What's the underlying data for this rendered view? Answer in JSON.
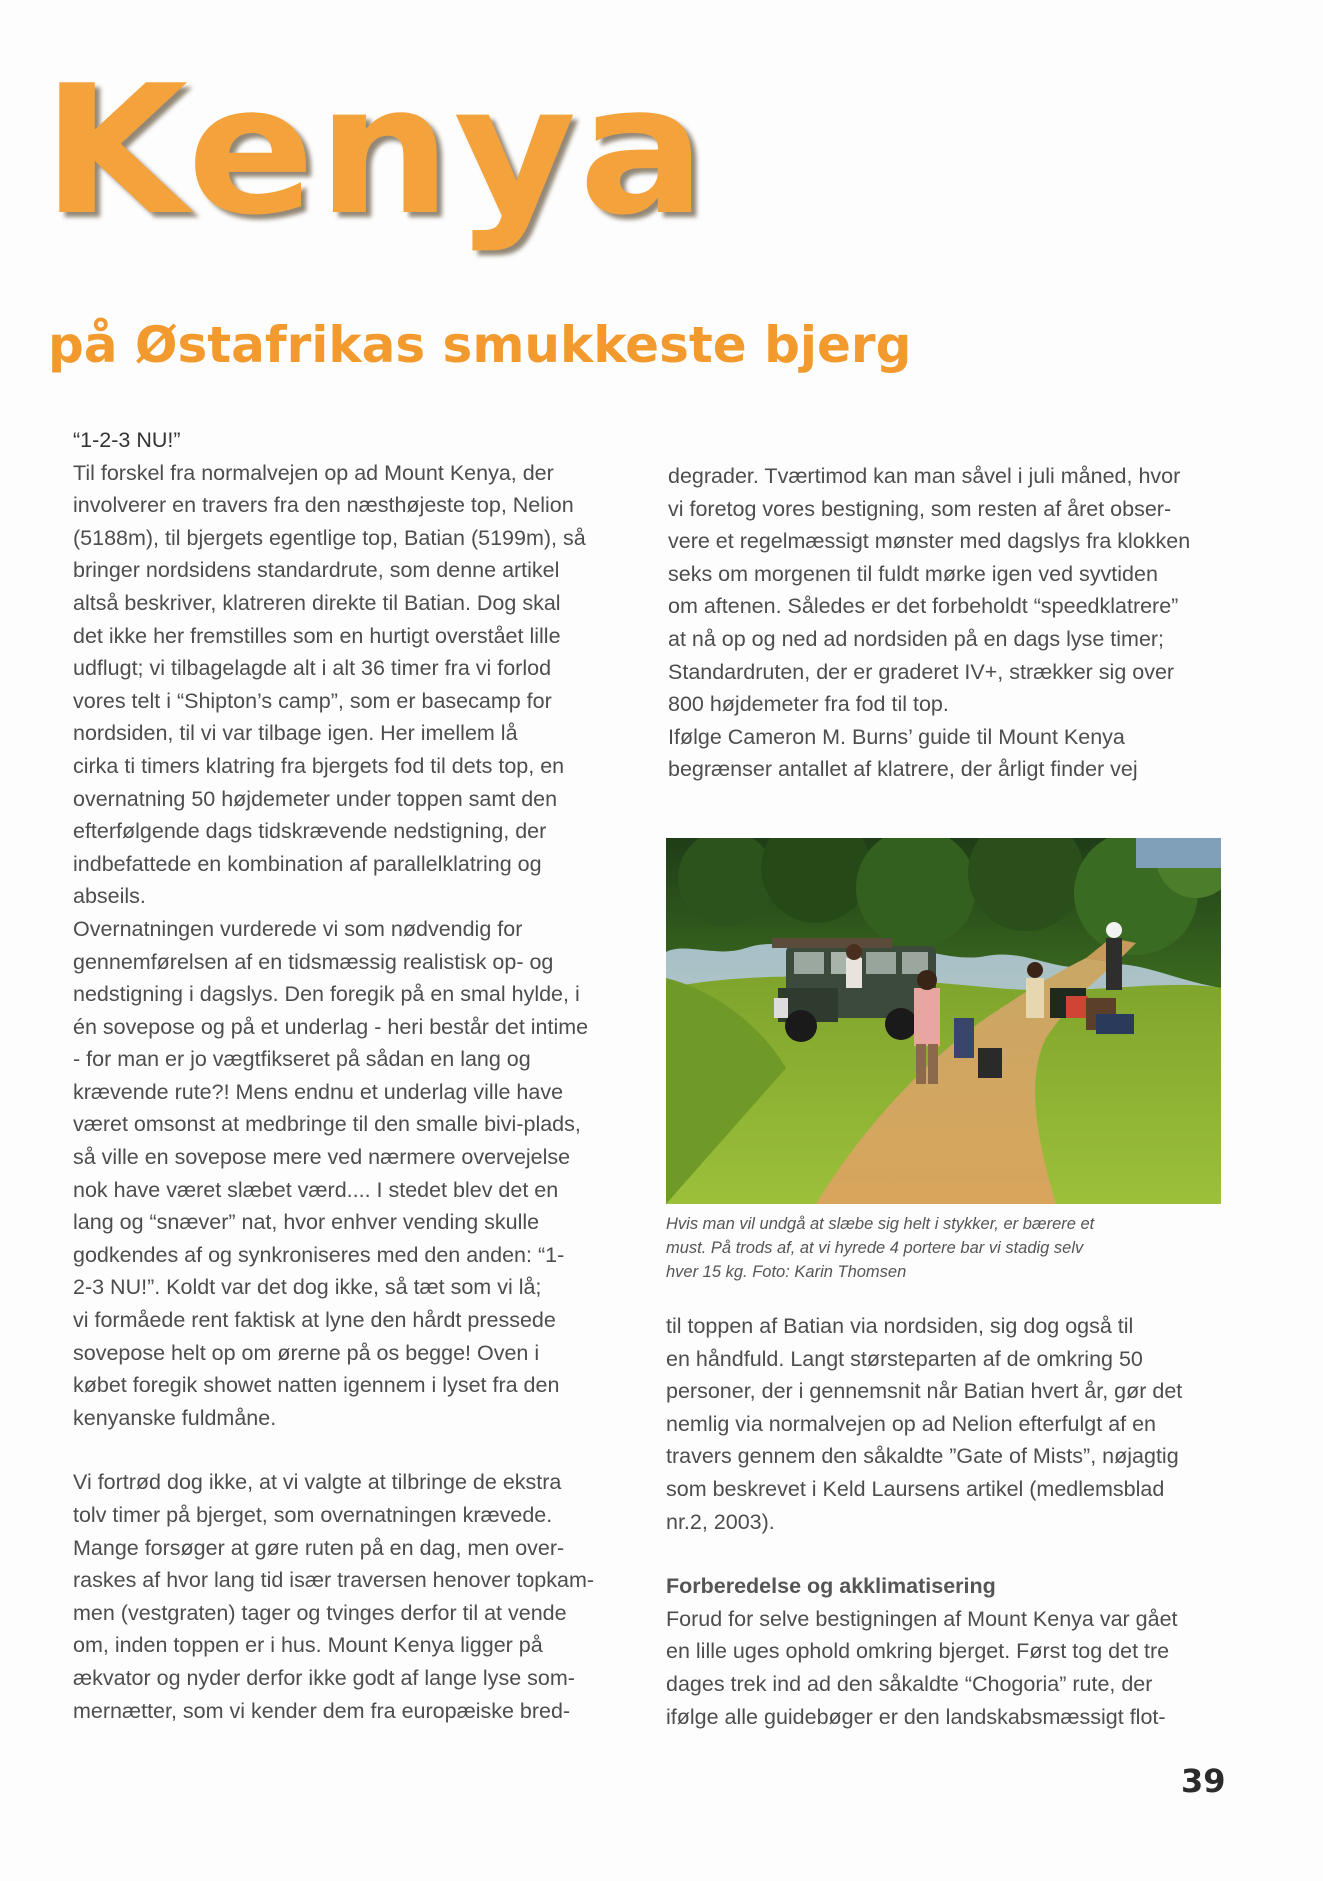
{
  "header": {
    "title": "Kenya",
    "subtitle": "på Østafrikas smukkeste bjerg"
  },
  "article": {
    "lede": "“1-2-3 NU!”",
    "left_paragraphs": [
      "Til forskel fra normalvejen op ad Mount Kenya, der\ninvolverer en travers fra den næsthøjeste top, Nelion\n(5188m), til bjergets egentlige top, Batian (5199m), så\nbringer nordsidens standardrute, som denne artikel\naltså beskriver, klatreren direkte til Batian. Dog skal\ndet ikke her fremstilles som en hurtigt overstået lille\nudflugt; vi tilbagelagde alt i alt 36 timer fra vi forlod\nvores telt i “Shipton’s camp”, som er basecamp for\nnordsiden, til vi var tilbage igen. Her imellem lå\ncirka ti timers klatring fra bjergets fod til dets top, en\novernatning 50 højdemeter under toppen samt den\nefterfølgende dags tidskrævende nedstigning, der\nindbefattede en kombination af parallelklatring og\nabseils.",
      "Overnatningen vurderede vi som nødvendig for\ngennemførelsen af en tidsmæssig realistisk op- og\nnedstigning i dagslys. Den foregik på en smal hylde, i\nén sovepose og på et underlag - heri består det intime\n- for man er jo vægtfikseret på sådan en lang og\nkrævende rute?! Mens endnu et underlag ville have\nværet omsonst at medbringe til den smalle bivi-plads,\nså ville en sovepose mere ved nærmere overvejelse\nnok have været slæbet værd.... I stedet blev det en\nlang og “snæver” nat, hvor enhver vending skulle\ngodkendes af og synkroniseres med den anden: “1-\n2-3 NU!”. Koldt var det dog ikke, så tæt som vi lå;\nvi formåede rent faktisk at lyne den hårdt pressede\nsovepose helt op om ørerne på os begge! Oven i\nkøbet foregik showet natten igennem i lyset fra den\nkenyanske fuldmåne.",
      "Vi fortrød dog ikke, at vi valgte at tilbringe de ekstra\ntolv timer på bjerget, som overnatningen krævede.\nMange forsøger at gøre ruten på en dag, men over-\nraskes af hvor lang tid især traversen henover topkam-\nmen (vestgraten) tager og tvinges derfor til at vende\nom, inden toppen er i hus. Mount Kenya ligger på\nækvator og nyder derfor ikke godt af lange lyse som-\nmernætter, som vi kender dem fra europæiske bred-"
    ],
    "right_top_paragraphs": [
      "degrader. Tværtimod kan man såvel i juli måned, hvor\nvi foretog vores bestigning, som resten af året obser-\nvere et regelmæssigt mønster med dagslys fra klokken\nseks om morgenen til fuldt mørke igen ved syvtiden\nom aftenen. Således er det forbeholdt “speedklatrere”\nat nå op og ned ad nordsiden på en dags lyse timer;\nStandardruten, der er graderet IV+, strækker sig over\n800 højdemeter fra fod til top.",
      "Ifølge Cameron M. Burns’ guide til Mount Kenya\nbegrænser antallet af klatrere, der årligt finder vej"
    ],
    "photo_caption": "Hvis man vil undgå at slæbe sig helt i stykker, er bærere et\nmust. På trods af, at vi hyrede 4 portere bar vi stadig selv\nhver 15 kg. Foto: Karin Thomsen",
    "right_bottom_paragraphs": [
      "til toppen af Batian via nordsiden, sig dog også til\nen håndfuld. Langt størsteparten af de omkring 50\npersoner, der i gennemsnit når Batian hvert år, gør det\nnemlig via normalvejen op ad Nelion efterfulgt af en\ntravers gennem den såkaldte ”Gate of Mists”, nøjagtig\nsom beskrevet i Keld Laursens artikel (medlemsblad\nnr.2, 2003)."
    ],
    "section_heading": "Forberedelse og akklimatisering",
    "section_paragraph": "Forud for selve bestigningen af Mount Kenya var gået\nen lille uges ophold omkring bjerget. Først tog det tre\ndages trek ind ad den såkaldte “Chogoria” rute, der\nifølge alle guidebøger er den landskabsmæssigt flot-"
  },
  "footer": {
    "page_number": "39"
  },
  "colors": {
    "title_orange": "#f4a23c",
    "subtitle_orange": "#f29a2e",
    "body_text": "#4d4d4d"
  }
}
